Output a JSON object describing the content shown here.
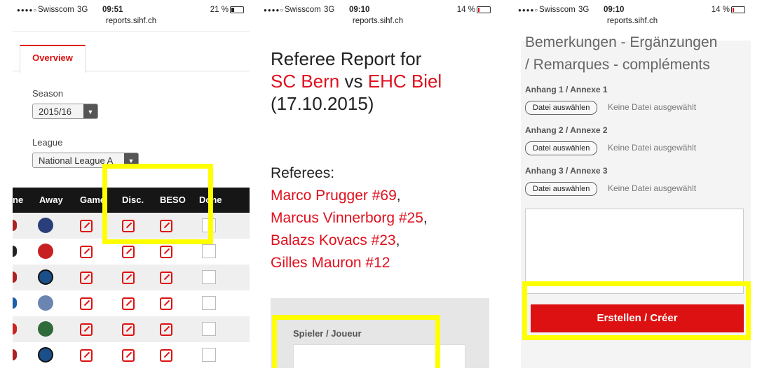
{
  "phone1": {
    "status": {
      "carrier": "Swisscom",
      "network": "3G",
      "time": "09:51",
      "battery": "21 %"
    },
    "url": "reports.sihf.ch",
    "tab": "Overview",
    "season_label": "Season",
    "season_value": "2015/16",
    "league_label": "League",
    "league_value": "National League A",
    "columns": [
      "ne",
      "Away",
      "Game",
      "Disc.",
      "BESO",
      "Done"
    ]
  },
  "phone2": {
    "status": {
      "carrier": "Swisscom",
      "network": "3G",
      "time": "09:10",
      "battery": "14 %"
    },
    "url": "reports.sihf.ch",
    "title_line1": "Referee Report for",
    "home_team": "SC Bern",
    "vs": "vs",
    "away_team": "EHC Biel",
    "date": "(17.10.2015)",
    "referees_label": "Referees:",
    "referees": [
      "Marco Prugger #69",
      "Marcus Vinnerborg #25",
      "Balazs Kovacs #23",
      "Gilles Mauron #12"
    ],
    "comma": ",",
    "player_label": "Spieler / Joueur"
  },
  "phone3": {
    "status": {
      "carrier": "Swisscom",
      "network": "3G",
      "time": "09:10",
      "battery": "14 %"
    },
    "url": "reports.sihf.ch",
    "heading_line1": "Bemerkungen - Ergänzungen",
    "heading_line2": "/ Remarques - compléments",
    "annex1": "Anhang 1 / Annexe 1",
    "annex2": "Anhang 2 / Annexe 2",
    "annex3": "Anhang 3 / Annexe 3",
    "choose_file": "Datei auswählen",
    "no_file": "Keine Datei ausgewählt",
    "submit": "Erstellen / Créer"
  },
  "colors": {
    "accent": "#e0101e",
    "highlight": "#ffff00",
    "table_header": "#161616"
  }
}
